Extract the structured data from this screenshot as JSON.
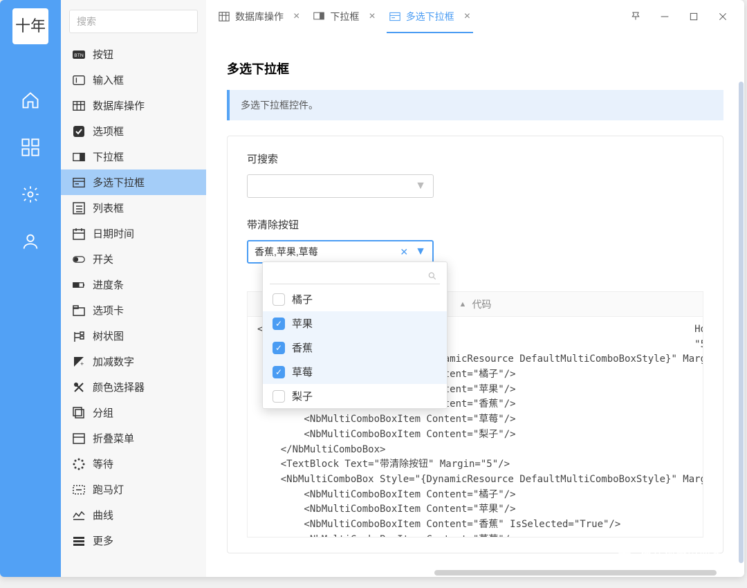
{
  "logo_text": "十年",
  "search_placeholder": "搜索",
  "tabs": [
    {
      "label": "数据库操作",
      "active": false
    },
    {
      "label": "下拉框",
      "active": false
    },
    {
      "label": "多选下拉框",
      "active": true
    }
  ],
  "sidebar": {
    "items": [
      {
        "label": "按钮"
      },
      {
        "label": "输入框"
      },
      {
        "label": "数据库操作"
      },
      {
        "label": "选项框"
      },
      {
        "label": "下拉框"
      },
      {
        "label": "多选下拉框"
      },
      {
        "label": "列表框"
      },
      {
        "label": "日期时间"
      },
      {
        "label": "开关"
      },
      {
        "label": "进度条"
      },
      {
        "label": "选项卡"
      },
      {
        "label": "树状图"
      },
      {
        "label": "加减数字"
      },
      {
        "label": "颜色选择器"
      },
      {
        "label": "分组"
      },
      {
        "label": "折叠菜单"
      },
      {
        "label": "等待"
      },
      {
        "label": "跑马灯"
      },
      {
        "label": "曲线"
      },
      {
        "label": "更多"
      }
    ],
    "active_index": 5
  },
  "page": {
    "title": "多选下拉框",
    "info": "多选下拉框控件。",
    "field1_label": "可搜索",
    "field2_label": "带清除按钮",
    "combo2_value": "香蕉,苹果,草莓",
    "dropdown_options": [
      {
        "label": "橘子",
        "checked": false
      },
      {
        "label": "苹果",
        "checked": true
      },
      {
        "label": "香蕉",
        "checked": true
      },
      {
        "label": "草莓",
        "checked": true
      },
      {
        "label": "梨子",
        "checked": false
      }
    ],
    "code_header": "代码",
    "code_body": "<S                                                                         HorizontalAlignment=\"Left\">\n                                                                           \"5\"/>\n    <NbMultiComboBox Style=\"{DynamicResource DefaultMultiComboBoxStyle}\" Margin=\"5\">\n        <NbMultiComboBoxItem Content=\"橘子\"/>\n        <NbMultiComboBoxItem Content=\"苹果\"/>\n        <NbMultiComboBoxItem Content=\"香蕉\"/>\n        <NbMultiComboBoxItem Content=\"草莓\"/>\n        <NbMultiComboBoxItem Content=\"梨子\"/>\n    </NbMultiComboBox>\n    <TextBlock Text=\"带清除按钮\" Margin=\"5\"/>\n    <NbMultiComboBox Style=\"{DynamicResource DefaultMultiComboBoxStyle}\" Margin=\"5\">\n        <NbMultiComboBoxItem Content=\"橘子\"/>\n        <NbMultiComboBoxItem Content=\"苹果\"/>\n        <NbMultiComboBoxItem Content=\"香蕉\" IsSelected=\"True\"/>\n        <NbMultiComboBoxItem Content=\"草莓\"/>"
  },
  "watermark": "独立观察员博客"
}
